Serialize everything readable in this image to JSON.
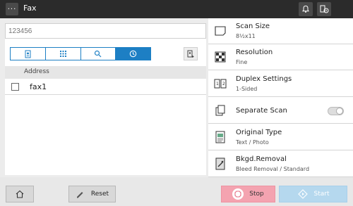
{
  "topbar": {
    "title": "Fax"
  },
  "destination": {
    "placeholder": "123456"
  },
  "address_list": {
    "header": "Address",
    "rows": [
      {
        "name": "fax1"
      }
    ]
  },
  "settings": [
    {
      "label": "Scan Size",
      "value": "8½x11"
    },
    {
      "label": "Resolution",
      "value": "Fine"
    },
    {
      "label": "Duplex Settings",
      "value": "1-Sided"
    },
    {
      "label": "Separate Scan",
      "value": ""
    },
    {
      "label": "Original Type",
      "value": "Text / Photo"
    },
    {
      "label": "Bkgd.Removal",
      "value": "Bleed Removal / Standard"
    }
  ],
  "buttons": {
    "reset": "Reset",
    "stop": "Stop",
    "start": "Start"
  },
  "colors": {
    "accent": "#1d7fc4",
    "stop": "#f4a3b0",
    "start": "#b5d8ee",
    "topbar": "#2b2b2b"
  }
}
